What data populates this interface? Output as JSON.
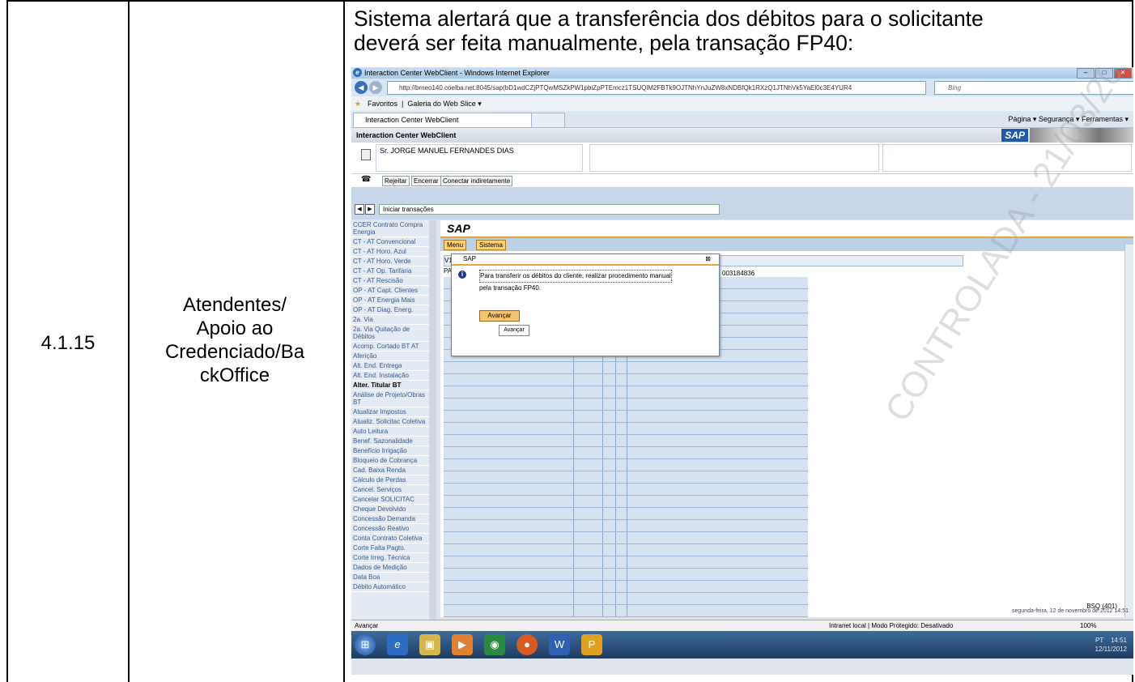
{
  "row": {
    "number": "4.1.15",
    "role_lines": [
      "Atendentes/",
      "Apoio ao",
      "Credenciado/Ba",
      "ckOffice"
    ],
    "description_lines": [
      "Sistema alertará que a transferência dos débitos para o solicitante",
      "deverá ser feita manualmente, pela transação FP40:"
    ]
  },
  "browser": {
    "window_title": "Interaction Center WebClient - Windows Internet Explorer",
    "url": "http://brneo140.coelba.net:8045/sap(bD1wdCZjPTQwMSZkPW1pbiZpPTEmcz1TSUQlM2FBTk9OJTNhYnJuZW8xNDBfQk1RXzQ1JTNhVk5YaEl0c3E4YUR4",
    "search_placeholder": "Bing",
    "favorites_label": "Favoritos",
    "favorites_item": "Galeria do Web Slice ▾",
    "tab_label": "Interaction Center WebClient",
    "command_bar": "Página ▾  Segurança ▾  Ferramentas ▾",
    "status_left": "Avançar",
    "status_zone": "Intranet local | Modo Protegido: Desativado",
    "zoom": "100%"
  },
  "webclient": {
    "header_title": "Interaction Center WebClient",
    "logo": "SAP",
    "customer_name": "Sr. JORGE MANUEL FERNANDES DIAS",
    "call_buttons": [
      "Rejeitar",
      "Encerrar",
      "Conectar indiretamente"
    ],
    "transaction_select": "Iniciar transações",
    "sap_title": "SAP",
    "menu_items": [
      "Menu",
      "Sistema"
    ],
    "bp_number": "003184836",
    "row_prefixes": [
      "V1",
      "PA"
    ],
    "queue_status": "BSQ (401)",
    "date_line": "segunda-feira, 12 de novembro de 2012 14:51"
  },
  "sidebar_items": [
    "CCER Contrato Compra Energia",
    "CT - AT Convencional",
    "CT - AT Horo. Azul",
    "CT - AT Horo. Verde",
    "CT - AT Op. Tarifária",
    "CT - AT Rescisão",
    "OP - AT Capt. Clientes",
    "OP - AT Energia Mais",
    "OP - AT Diag. Energ.",
    "2a. Via",
    "2a. Via Quitação de Débitos",
    "Acomp. Cortado BT AT",
    "Aferição",
    "Alt. End. Entrega",
    "Alt. End. Instalação",
    "Alter. Titular BT",
    "Análise de Projeto/Obras BT",
    "Atualizar Impostos",
    "Atualiz. Solicitac Coletiva",
    "Auto Leitura",
    "Benef. Sazonalidade",
    "Benefício Irrigação",
    "Bloqueio de Cobrança",
    "Cad. Baixa Renda",
    "Cálculo de Perdas",
    "Cancel. Serviços",
    "Cancelar SOLICITAC",
    "Cheque Devolvido",
    "Concessão Demanda",
    "Concessão Reativo",
    "Conta Contrato Coletiva",
    "Corte Falta Pagto.",
    "Corte Irreg. Técnica",
    "Dados de Medição",
    "Data Boa",
    "Débito Automático"
  ],
  "active_sidebar_item": "Alter. Titular BT",
  "dialog": {
    "title": "SAP",
    "message_line1": "Para transferir os débitos do cliente, realizar procedimento manual",
    "message_line2": "pela transação FP40.",
    "button": "Avançar",
    "tooltip": "Avançar"
  },
  "taskbar": {
    "language": "PT",
    "time": "14:51",
    "date": "12/11/2012"
  },
  "watermark": "CONTROLADA - 21/03/2018"
}
